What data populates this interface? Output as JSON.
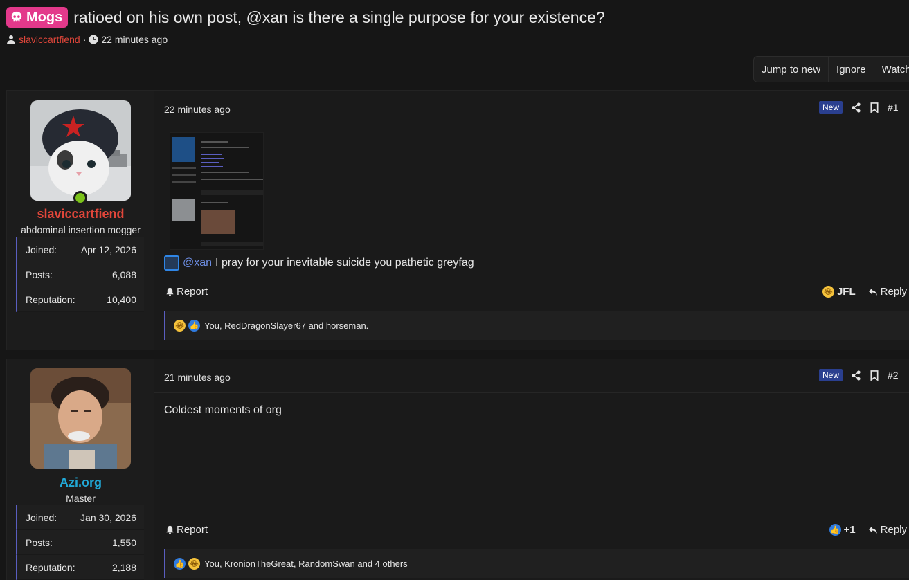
{
  "thread": {
    "prefix": "Mogs",
    "title": "ratioed on his own post, @xan is there a single purpose for your existence?",
    "author": "slaviccartfiend",
    "time": "22 minutes ago",
    "separator": "·"
  },
  "thread_actions": [
    "Jump to new",
    "Ignore",
    "Watch"
  ],
  "posts": [
    {
      "username": "slaviccartfiend",
      "username_color": "#e0463a",
      "user_title": "abdominal insertion mogger",
      "online": true,
      "stats": [
        {
          "label": "Joined:",
          "value": "Apr 12, 2026"
        },
        {
          "label": "Posts:",
          "value": "6,088"
        },
        {
          "label": "Reputation:",
          "value": "10,400"
        }
      ],
      "time": "22 minutes ago",
      "new_badge": "New",
      "number": "#1",
      "mention": "@xan",
      "body": " I pray for your inevitable suicide you pathetic greyfag",
      "report": "Report",
      "reaction_button": "JFL",
      "reply": "Reply",
      "reactions_text": "You, RedDragonSlayer67 and horseman."
    },
    {
      "username": "Azi.org",
      "username_color": "#21a8d6",
      "user_title": "Master",
      "stats": [
        {
          "label": "Joined:",
          "value": "Jan 30, 2026"
        },
        {
          "label": "Posts:",
          "value": "1,550"
        },
        {
          "label": "Reputation:",
          "value": "2,188"
        }
      ],
      "time": "21 minutes ago",
      "new_badge": "New",
      "number": "#2",
      "body": "Coldest moments of org",
      "report": "Report",
      "reaction_button": "+1",
      "reply": "Reply",
      "reactions_text": "You, KronionTheGreat, RandomSwan and 4 others"
    }
  ]
}
